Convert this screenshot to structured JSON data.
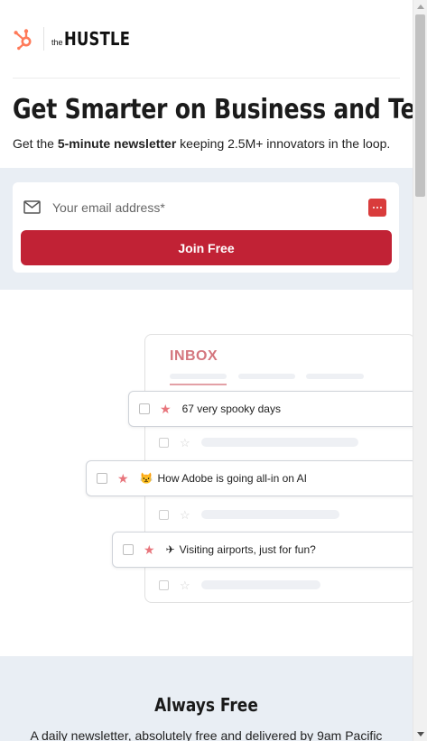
{
  "header": {
    "brand_prefix": "the",
    "brand_name": "HUSTLE",
    "logo_icon": "hubspot-sprocket-icon"
  },
  "hero": {
    "headline": "Get Smarter on Business and Tech",
    "subline_before": "Get the ",
    "subline_bold": "5-minute newsletter",
    "subline_after": " keeping 2.5M+ innovators in the loop."
  },
  "signup": {
    "email_placeholder": "Your email address*",
    "email_value": "",
    "join_label": "Join Free",
    "mail_icon": "envelope-icon",
    "password_manager_icon": "password-dots-icon"
  },
  "inbox": {
    "title": "INBOX",
    "messages": [
      {
        "emoji": "",
        "text": "67 very spooky days"
      },
      {
        "emoji": "😾",
        "text": "How Adobe is going all-in on AI"
      },
      {
        "emoji": "✈",
        "text": "Visiting airports, just for fun?"
      }
    ]
  },
  "footer_section": {
    "title": "Always Free",
    "text": "A daily newsletter, absolutely free and delivered by 9am Pacific"
  },
  "colors": {
    "accent": "#c12235",
    "inbox_title": "#d4767e",
    "band_background": "#e9eef4"
  }
}
